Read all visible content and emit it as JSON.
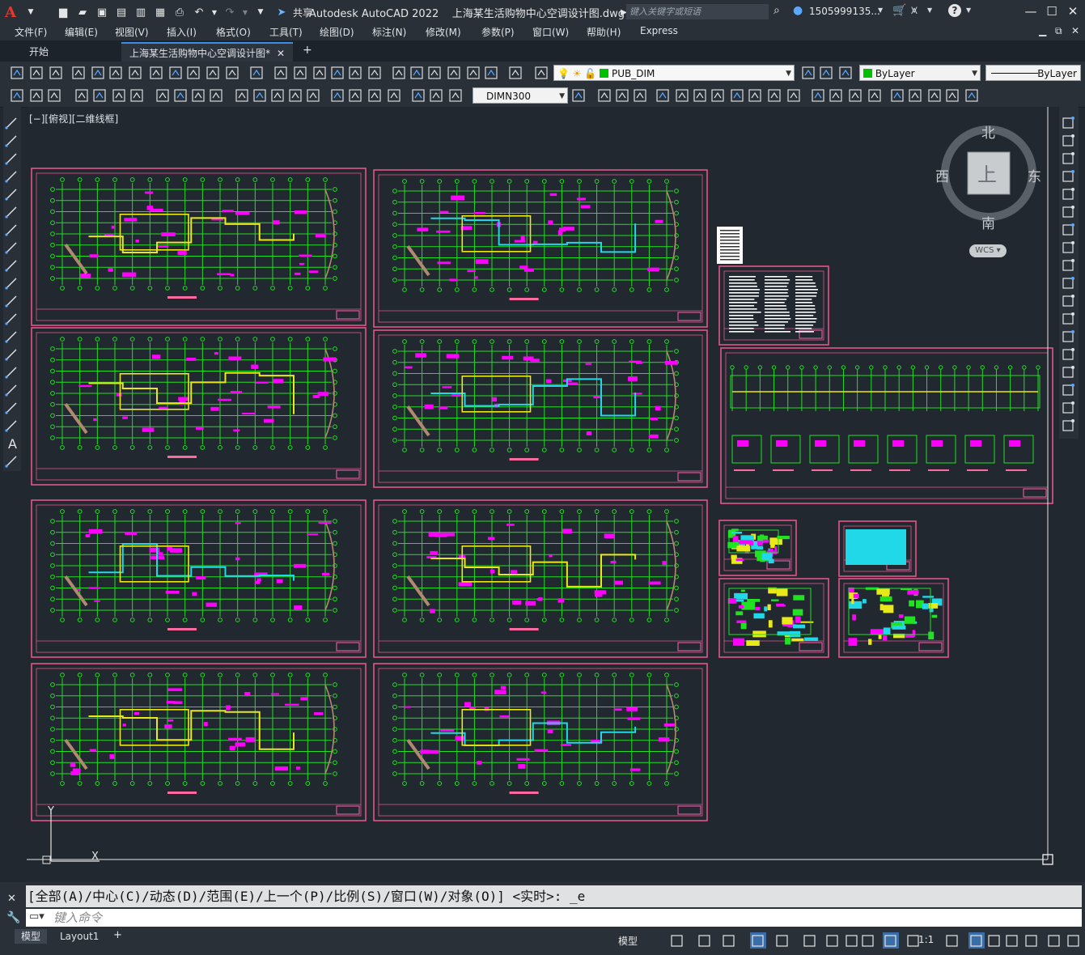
{
  "app": {
    "title": "Autodesk AutoCAD 2022",
    "file": "上海某生活购物中心空调设计图.dwg",
    "share_label": "共享",
    "search_placeholder": "键入关键字或短语",
    "user": "1505999135..."
  },
  "menu": [
    "文件(F)",
    "编辑(E)",
    "视图(V)",
    "插入(I)",
    "格式(O)",
    "工具(T)",
    "绘图(D)",
    "标注(N)",
    "修改(M)",
    "参数(P)",
    "窗口(W)",
    "帮助(H)",
    "Express"
  ],
  "tabs": [
    {
      "label": "开始"
    },
    {
      "label": "上海某生活购物中心空调设计图*"
    }
  ],
  "layer": {
    "current": "PUB_DIM",
    "color": "#00c000"
  },
  "properties": {
    "color": "ByLayer",
    "linetype": "ByLayer"
  },
  "dimstyle": "DIMN300",
  "viewport_label": "[−][俯视][二维线框]",
  "viewcube": {
    "north": "北",
    "south": "南",
    "east": "东",
    "west": "西",
    "face": "上",
    "wcs": "WCS"
  },
  "ucs": {
    "y": "Y",
    "x": "X"
  },
  "command": {
    "history": "[全部(A)/中心(C)/动态(D)/范围(E)/上一个(P)/比例(S)/窗口(W)/对象(O)] <实时>: _e",
    "placeholder": "键入命令"
  },
  "layout_tabs": [
    "模型",
    "Layout1"
  ],
  "status": {
    "model_label": "模型",
    "scale": "1:1"
  },
  "colors": {
    "frame": "#e2558a",
    "grid": "#22e022",
    "accent": "#ff00ff",
    "duct_yellow": "#e8e81a",
    "duct_cyan": "#20d8e8",
    "bg": "#212830"
  }
}
